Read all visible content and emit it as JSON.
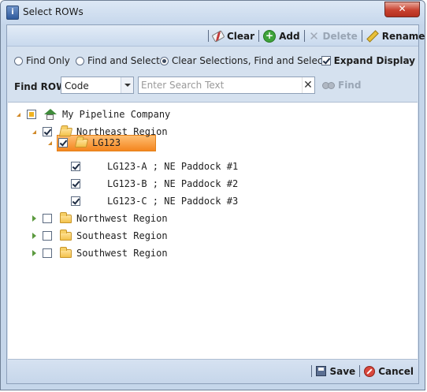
{
  "window": {
    "title": "Select ROWs",
    "close_glyph": "✕",
    "app_icon_glyph": "i"
  },
  "toolbar": {
    "clear_label": "Clear",
    "add_label": "Add",
    "delete_label": "Delete",
    "rename_label": "Rename"
  },
  "options": {
    "find_only": "Find Only",
    "find_and_select": "Find and Select",
    "clear_find_select": "Clear Selections, Find and Select",
    "selected": "clear_find_select",
    "expand_display": "Expand Display",
    "expand_display_checked": true
  },
  "find": {
    "label": "Find ROW",
    "field_value": "Code",
    "search_placeholder": "Enter Search Text",
    "search_value": "",
    "clear_glyph": "✕",
    "find_label": "Find"
  },
  "tree": {
    "root": "My Pipeline Company",
    "northeast": "Northeast Region",
    "lg123": "LG123",
    "lg123a": "LG123-A ; NE Paddock #1",
    "lg123b": "LG123-B ; NE Paddock #2",
    "lg123c": "LG123-C ; NE Paddock #3",
    "northwest": "Northwest Region",
    "southeast": "Southeast Region",
    "southwest": "Southwest Region"
  },
  "footer": {
    "save_label": "Save",
    "cancel_label": "Cancel"
  },
  "colors": {
    "selection": "#f4861f",
    "accent": "#3fa33a"
  }
}
